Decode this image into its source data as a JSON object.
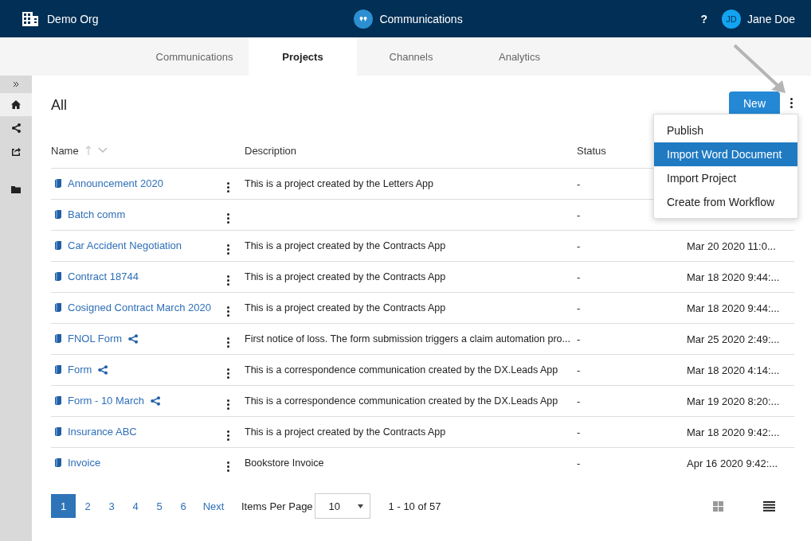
{
  "header": {
    "org": "Demo Org",
    "app_title": "Communications",
    "help": "?",
    "user": {
      "initials": "JD",
      "name": "Jane Doe"
    }
  },
  "tabs": [
    {
      "label": "Communications",
      "selected": false
    },
    {
      "label": "Projects",
      "selected": true
    },
    {
      "label": "Channels",
      "selected": false
    },
    {
      "label": "Analytics",
      "selected": false
    }
  ],
  "sidebar": {
    "items": [
      {
        "kind": "home",
        "selected": true
      },
      {
        "kind": "share",
        "selected": false
      },
      {
        "kind": "export",
        "selected": false
      },
      {
        "kind": "folder",
        "selected": false
      }
    ]
  },
  "page": {
    "title": "All",
    "new_button": "New"
  },
  "menu": {
    "items": [
      {
        "label": "Publish",
        "selected": false
      },
      {
        "label": "Import Word Document",
        "selected": true
      },
      {
        "label": "Import Project",
        "selected": false
      },
      {
        "label": "Create from Workflow",
        "selected": false
      }
    ]
  },
  "table": {
    "columns": [
      "Name",
      "Description",
      "Status"
    ],
    "rows": [
      {
        "name": "Announcement 2020",
        "shared": false,
        "description": "This is a project created by the Letters App",
        "status": "-"
      },
      {
        "name": "Batch comm",
        "shared": false,
        "status": "-"
      },
      {
        "name": "Car Accident Negotiation",
        "shared": false,
        "description": "This is a project created by the Contracts App",
        "status": "-",
        "date": "Mar 20 2020 11:0..."
      },
      {
        "name": "Contract 18744",
        "shared": false,
        "description": "This is a project created by the Contracts App",
        "status": "-",
        "date": "Mar 18 2020 9:44:..."
      },
      {
        "name": "Cosigned Contract March 2020",
        "shared": false,
        "description": "This is a project created by the Contracts App",
        "status": "-",
        "date": "Mar 18 2020 9:44:..."
      },
      {
        "name": "FNOL Form",
        "shared": true,
        "description": "First notice of loss. The form submission triggers a claim automation pro...",
        "status": "-",
        "date": "Mar 25 2020 2:49:..."
      },
      {
        "name": "Form",
        "shared": true,
        "description": "This is a correspondence communication created by the DX.Leads App",
        "status": "-",
        "date": "Mar 18 2020 4:14:..."
      },
      {
        "name": "Form - 10 March",
        "shared": true,
        "description": "This is a correspondence communication created by the DX.Leads App",
        "status": "-",
        "date": "Mar 19 2020 8:20:..."
      },
      {
        "name": "Insurance ABC",
        "shared": false,
        "description": "This is a project created by the Contracts App",
        "status": "-",
        "date": "Mar 18 2020 9:42:..."
      },
      {
        "name": "Invoice",
        "shared": false,
        "description": "Bookstore Invoice",
        "status": "-",
        "date": "Apr 16 2020 9:42:..."
      }
    ]
  },
  "pagination": {
    "pages": [
      {
        "label": "1",
        "selected": true
      },
      {
        "label": "2",
        "selected": false
      },
      {
        "label": "3",
        "selected": false
      },
      {
        "label": "4",
        "selected": false
      },
      {
        "label": "5",
        "selected": false
      },
      {
        "label": "6",
        "selected": false
      }
    ],
    "next": "Next",
    "items_per_page_label": "Items Per Page",
    "items_per_page": "10",
    "range": "1 - 10 of 57"
  },
  "view_modes": [
    {
      "kind": "grid",
      "selected": false
    },
    {
      "kind": "list",
      "selected": true
    }
  ]
}
